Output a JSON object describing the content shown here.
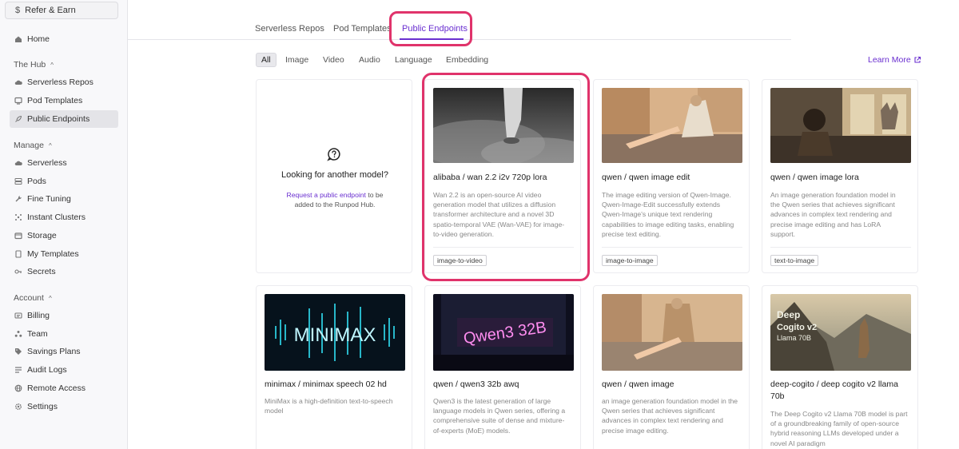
{
  "sidebar": {
    "refer_label": "Refer & Earn",
    "home": "Home",
    "hub_section": "The Hub",
    "serverless_repos": "Serverless Repos",
    "pod_templates": "Pod Templates",
    "public_endpoints": "Public Endpoints",
    "manage_section": "Manage",
    "serverless": "Serverless",
    "pods": "Pods",
    "fine_tuning": "Fine Tuning",
    "instant_clusters": "Instant Clusters",
    "storage": "Storage",
    "my_templates": "My Templates",
    "secrets": "Secrets",
    "account_section": "Account",
    "billing": "Billing",
    "team": "Team",
    "savings_plans": "Savings Plans",
    "audit_logs": "Audit Logs",
    "remote_access": "Remote Access",
    "settings": "Settings"
  },
  "tabs": {
    "serverless_repos": "Serverless Repos",
    "pod_templates": "Pod Templates",
    "public_endpoints": "Public Endpoints"
  },
  "filters": {
    "all": "All",
    "image": "Image",
    "video": "Video",
    "audio": "Audio",
    "language": "Language",
    "embedding": "Embedding"
  },
  "learn_more": "Learn More",
  "empty_card": {
    "title": "Looking for another model?",
    "link": "Request a public endpoint",
    "text_after_link": " to be",
    "text_line2": "added to the Runpod Hub."
  },
  "cards": [
    {
      "title": "alibaba / wan 2.2 i2v 720p lora",
      "desc": [
        "Wan 2.2 is an open-source AI video",
        "generation model that utilizes a diffusion",
        "transformer architecture and a novel 3D",
        "spatio-temporal VAE (Wan-VAE) for image-",
        "to-video generation."
      ],
      "tag": "image-to-video"
    },
    {
      "title": "qwen / qwen image edit",
      "desc": [
        "The image editing version of Qwen-Image.",
        "Qwen-Image-Edit successfully extends",
        "Qwen-Image's unique text rendering",
        "capabilities to image editing tasks, enabling",
        "precise text editing."
      ],
      "tag": "image-to-image"
    },
    {
      "title": "qwen / qwen image lora",
      "desc": [
        "An image generation foundation model in",
        "the Qwen series that achieves significant",
        "advances in complex text rendering and",
        "precise image editing and has LoRA",
        "support."
      ],
      "tag": "text-to-image"
    },
    {
      "title": "minimax / minimax speech 02 hd",
      "desc": [
        "MiniMax is a high-definition text-to-speech",
        "model"
      ],
      "image_text": "MINIMAX"
    },
    {
      "title": "qwen / qwen3 32b awq",
      "desc": [
        "Qwen3 is the latest generation of large",
        "language models in Qwen series, offering a",
        "comprehensive suite of dense and mixture-",
        "of-experts (MoE) models."
      ],
      "image_text": "Qwen3 32B"
    },
    {
      "title": "qwen / qwen image",
      "desc": [
        "an image generation foundation model in the",
        "Qwen series that achieves significant",
        "advances in complex text rendering and",
        "precise image editing."
      ]
    },
    {
      "title_lines": [
        "deep-cogito / deep cogito v2 llama",
        "70b"
      ],
      "desc": [
        "The Deep Cogito v2 Llama 70B model is part",
        "of a groundbreaking family of open-source",
        "hybrid reasoning LLMs developed under a",
        "novel AI paradigm"
      ],
      "image_text": [
        "Deep",
        "Cogito v2",
        "Llama 70B"
      ]
    }
  ],
  "colors": {
    "accent": "#6a2fd0",
    "highlight": "#e0336b"
  }
}
